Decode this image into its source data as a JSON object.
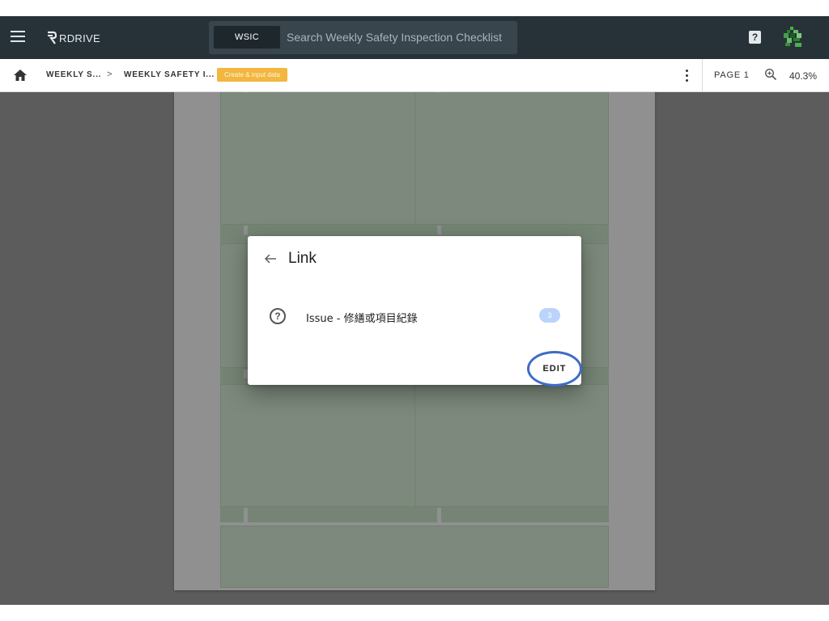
{
  "appbar": {
    "logo_text": "RDRIVE",
    "search_chip": "WSIC",
    "search_placeholder": "Search Weekly Safety Inspection Checklist",
    "help_glyph": "?",
    "icons": [
      "menu-icon",
      "logo-icon",
      "help-icon",
      "avatar"
    ]
  },
  "breadcrumb": {
    "items": [
      "WEEKLY S...",
      "WEEKLY SAFETY I..."
    ],
    "separator": ">",
    "status_badge": "Create & input data"
  },
  "viewer": {
    "page_label": "PAGE 1",
    "zoom": "40.3%"
  },
  "dialog": {
    "title": "Link",
    "back_glyph": "←",
    "items": [
      {
        "label": "Issue - 修繕或項目紀錄",
        "count": "3",
        "icon": "question-icon"
      }
    ],
    "edit_label": "EDIT"
  },
  "colors": {
    "appbar_bg": "#263238",
    "badge_amber": "#f3b63f",
    "count_badge": "#bcd3fb",
    "edit_ring": "#3d6cc4",
    "sheet_green": "#cfe5cf"
  }
}
